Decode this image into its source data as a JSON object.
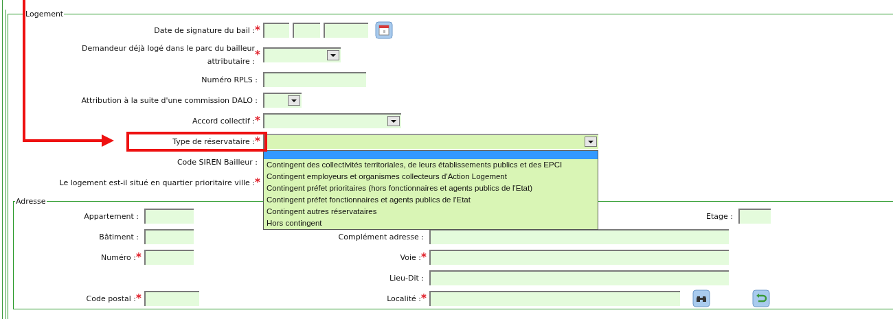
{
  "logement": {
    "legend": "Logement",
    "rows": [
      {
        "label": "Date de signature du bail :",
        "marker": "*",
        "kind": "date"
      },
      {
        "label": "Demandeur déjà logé dans le parc du bailleur\nattributaire :",
        "marker": "*",
        "kind": "select"
      },
      {
        "label": "Numéro RPLS :",
        "kind": "text"
      },
      {
        "label": "Attribution à la suite d'une commission DALO :",
        "kind": "select"
      },
      {
        "label": "Accord collectif :",
        "marker": "*",
        "kind": "select"
      },
      {
        "label": "Type de réservataire :",
        "marker": "*",
        "kind": "select",
        "open": true,
        "options": [
          {
            "selected": true
          },
          {
            "label": "Contingent des collectivités territoriales, de leurs établissements publics et des EPCI",
            "selected": false
          },
          {
            "label": "Contingent employeurs et organismes collecteurs d'Action Logement",
            "selected": false
          },
          {
            "label": "Contingent préfet prioritaires (hors fonctionnaires et agents publics de l'Etat)",
            "selected": false
          },
          {
            "label": "Contingent préfet fonctionnaires et agents publics de l'Etat",
            "selected": false
          },
          {
            "label": "Contingent autres réservataires",
            "selected": false
          },
          {
            "label": "Hors contingent",
            "selected": false
          }
        ]
      },
      {
        "label": "Code SIREN Bailleur :"
      },
      {
        "label": "Le logement est-il situé en quartier prioritaire ville :",
        "marker": "*"
      }
    ]
  },
  "adresse": {
    "legend": "Adresse",
    "rows": [
      {
        "left": {
          "label": "Appartement :"
        },
        "far": {
          "label": "Etage :"
        }
      },
      {
        "left": {
          "label": "Bâtiment :"
        },
        "right": {
          "label": "Complément adresse :"
        }
      },
      {
        "left": {
          "label": "Numéro :",
          "marker": "*"
        },
        "right": {
          "label": "Voie :",
          "marker": "*"
        }
      },
      {
        "right": {
          "label": "Lieu-Dit :"
        }
      },
      {
        "left": {
          "label": "Code postal :",
          "marker": "*"
        },
        "right": {
          "label": "Localité :",
          "marker": "*"
        },
        "actions": [
          {
            "kind": "search"
          },
          {
            "kind": "reset"
          }
        ]
      }
    ]
  }
}
